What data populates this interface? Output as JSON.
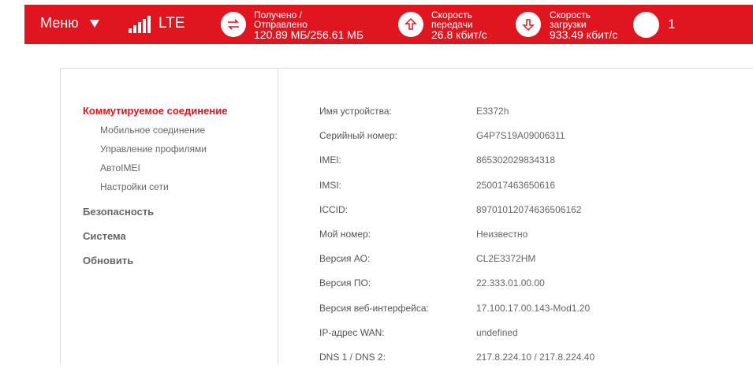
{
  "topbar": {
    "menu_label": "Меню",
    "network_type": "LTE",
    "signal_bars": 5,
    "traffic_label": "Получено / Отправлено",
    "traffic_label_1": "Получено /",
    "traffic_label_2": "Отправлено",
    "traffic_value": "120.89 МБ/256.61 МБ",
    "upload_label_1": "Скорость",
    "upload_label_2": "передачи",
    "upload_value": "26.8 кбит/с",
    "download_label_1": "Скорость",
    "download_label_2": "загрузки",
    "download_value": "933.49 кбит/с",
    "connected_users": "1",
    "accent_color": "#e0151f"
  },
  "sidebar": {
    "dialup": "Коммутируемое соединение",
    "sub_items": [
      {
        "label": "Мобильное соединение"
      },
      {
        "label": "Управление профилями"
      },
      {
        "label": "АвтоIMEI"
      },
      {
        "label": "Настройки сети"
      }
    ],
    "security": "Безопасность",
    "system": "Система",
    "update": "Обновить"
  },
  "device_info": [
    {
      "key": "Имя устройства:",
      "value": "E3372h"
    },
    {
      "key": "Серийный номер:",
      "value": "G4P7S19A09006311"
    },
    {
      "key": "IMEI:",
      "value": "865302029834318"
    },
    {
      "key": "IMSI:",
      "value": "250017463650616"
    },
    {
      "key": "ICCID:",
      "value": "89701012074636506162"
    },
    {
      "key": "Мой номер:",
      "value": "Неизвестно"
    },
    {
      "key": "Версия АО:",
      "value": "CL2E3372HM"
    },
    {
      "key": "Версия ПО:",
      "value": "22.333.01.00.00"
    },
    {
      "key": "Версия веб-интерфейса:",
      "value": "17.100.17.00.143-Mod1.20"
    },
    {
      "key": "IP-адрес WAN:",
      "value": "undefined"
    },
    {
      "key": "DNS 1 / DNS 2:",
      "value": "217.8.224.10 / 217.8.224.40"
    }
  ]
}
